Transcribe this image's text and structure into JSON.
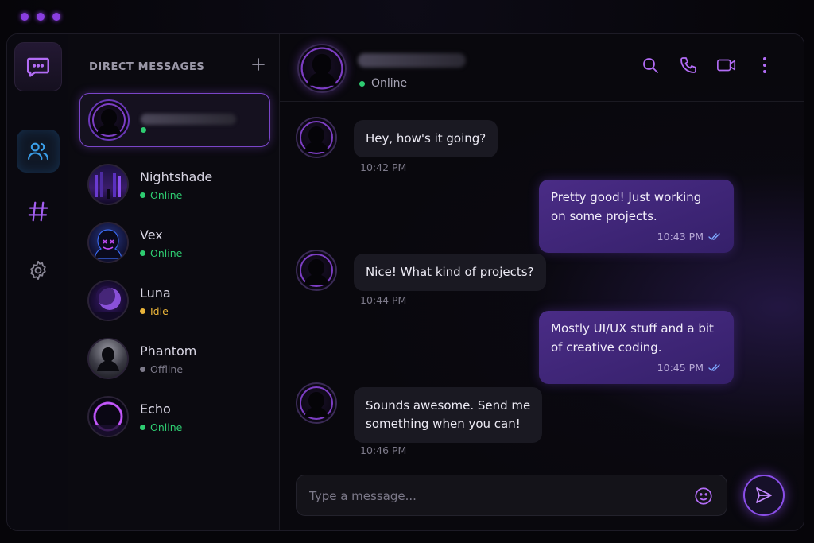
{
  "colors": {
    "accent": "#8a4ee8",
    "online": "#2ecc71",
    "idle": "#e8b33a",
    "offline": "#7d7a8a"
  },
  "sidebar": {
    "header": "DIRECT MESSAGES",
    "items": [
      {
        "name": "",
        "status": "",
        "status_type": "online",
        "active": true
      },
      {
        "name": "Nightshade",
        "status": "Online",
        "status_type": "online"
      },
      {
        "name": "Vex",
        "status": "Online",
        "status_type": "online"
      },
      {
        "name": "Luna",
        "status": "Idle",
        "status_type": "idle"
      },
      {
        "name": "Phantom",
        "status": "Offline",
        "status_type": "offline"
      },
      {
        "name": "Echo",
        "status": "Online",
        "status_type": "online"
      }
    ]
  },
  "chat": {
    "header": {
      "status": "Online"
    },
    "messages": [
      {
        "direction": "in",
        "lines": [
          "Hey, how's it going?"
        ],
        "time": "10:42 PM"
      },
      {
        "direction": "out",
        "lines": [
          "Pretty good! Just working",
          "on some projects."
        ],
        "time": "10:43 PM"
      },
      {
        "direction": "in",
        "lines": [
          "Nice! What kind of projects?"
        ],
        "time": "10:44 PM"
      },
      {
        "direction": "out",
        "lines": [
          "Mostly UI/UX stuff and a bit",
          "of creative coding."
        ],
        "time": "10:45 PM"
      },
      {
        "direction": "in",
        "lines": [
          "Sounds awesome. Send me",
          "something when you can!"
        ],
        "time": "10:46 PM"
      }
    ],
    "composer": {
      "placeholder": "Type a message..."
    }
  },
  "icons": [
    "chat-bubble-icon",
    "users-icon",
    "hash-icon",
    "gear-icon",
    "plus-icon",
    "search-icon",
    "phone-icon",
    "video-icon",
    "more-vertical-icon",
    "emoji-icon",
    "send-icon",
    "double-check-icon"
  ]
}
